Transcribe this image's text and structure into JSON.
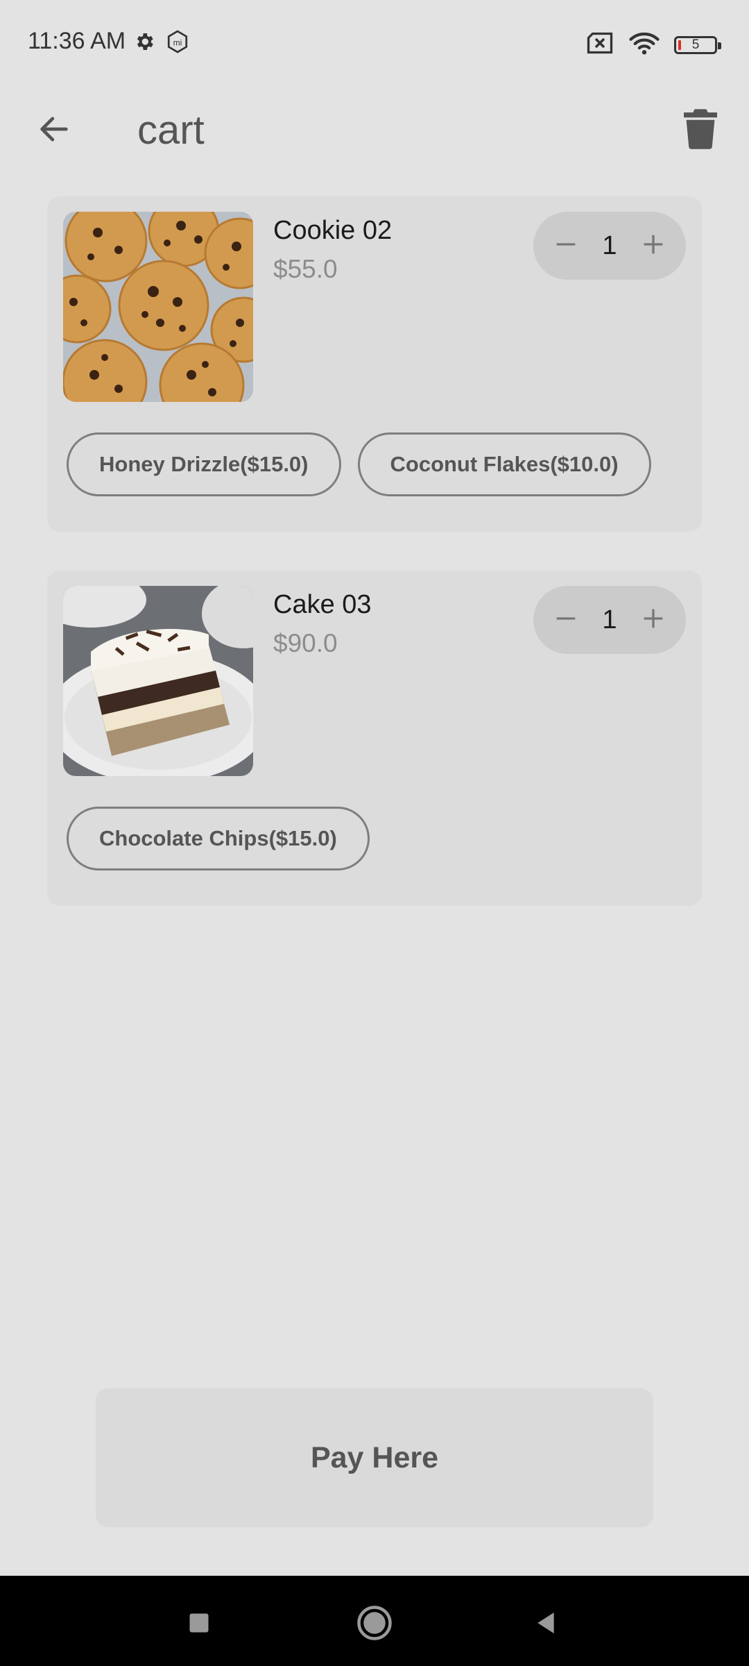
{
  "status_bar": {
    "time": "11:36 AM",
    "battery_level": "5",
    "icons": [
      "gear-icon",
      "mi-icon",
      "sim-blocked-icon",
      "wifi-icon",
      "battery-icon"
    ]
  },
  "app_bar": {
    "title": "cart",
    "back_icon": "arrow-left-icon",
    "delete_icon": "trash-icon"
  },
  "cart": {
    "items": [
      {
        "name": "Cookie 02",
        "price": "$55.0",
        "quantity": "1",
        "image": "chocolate-chip-cookies",
        "addons": [
          "Honey Drizzle($15.0)",
          "Coconut Flakes($10.0)"
        ]
      },
      {
        "name": "Cake 03",
        "price": "$90.0",
        "quantity": "1",
        "image": "layered-chocolate-cake-slice",
        "addons": [
          "Chocolate Chips($15.0)"
        ]
      }
    ]
  },
  "pay_button": {
    "label": "Pay Here"
  },
  "nav_bar": {
    "buttons": [
      "recents-icon",
      "home-icon",
      "back-icon"
    ]
  },
  "colors": {
    "background": "#e3e3e3",
    "card": "#dcdcdc",
    "stepper": "#cbcbcb",
    "price_text": "#8c8c8c",
    "battery_low": "#d93025"
  }
}
